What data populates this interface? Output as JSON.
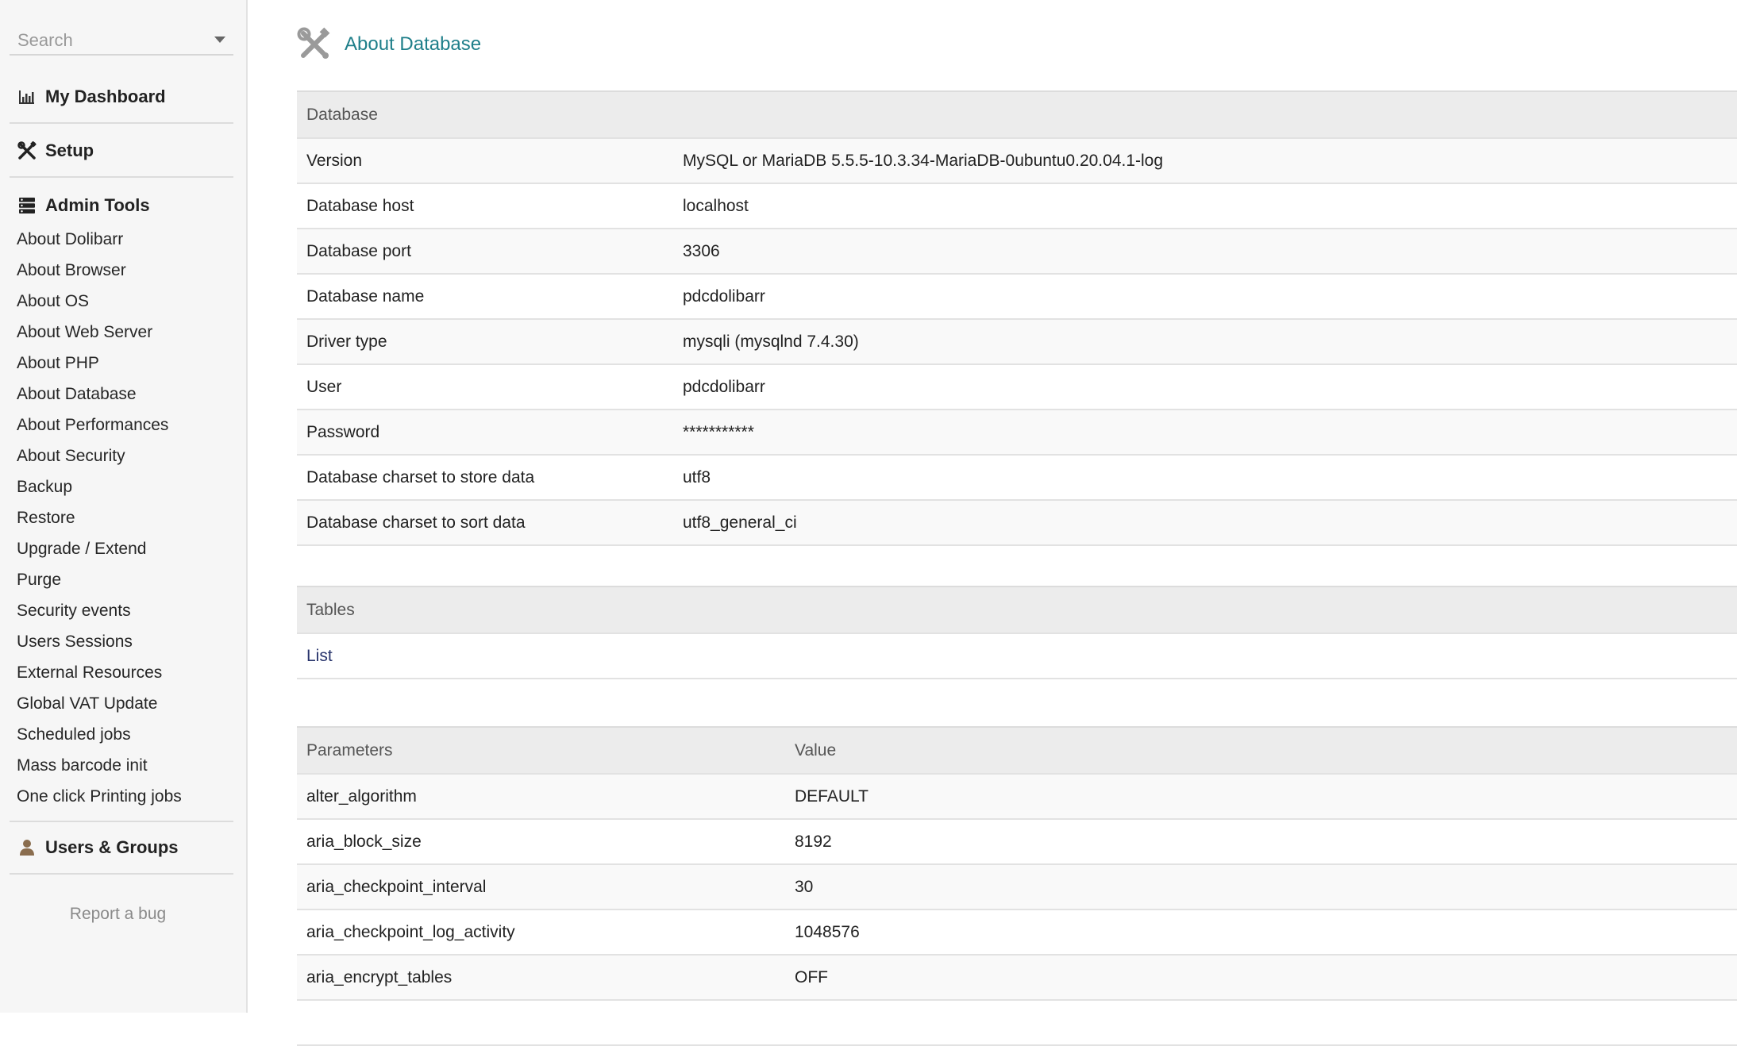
{
  "sidebar": {
    "search_placeholder": "Search",
    "dashboard": "My Dashboard",
    "setup": "Setup",
    "admin_tools": "Admin Tools",
    "admin_items": [
      "About Dolibarr",
      "About Browser",
      "About OS",
      "About Web Server",
      "About PHP",
      "About Database",
      "About Performances",
      "About Security",
      "Backup",
      "Restore",
      "Upgrade / Extend",
      "Purge",
      "Security events",
      "Users Sessions",
      "External Resources",
      "Global VAT Update",
      "Scheduled jobs",
      "Mass barcode init",
      "One click Printing jobs"
    ],
    "users_groups": "Users & Groups",
    "report_bug": "Report a bug"
  },
  "page": {
    "title": "About Database"
  },
  "database": {
    "header": "Database",
    "rows": [
      {
        "label": "Version",
        "value": "MySQL or MariaDB 5.5.5-10.3.34-MariaDB-0ubuntu0.20.04.1-log"
      },
      {
        "label": "Database host",
        "value": "localhost"
      },
      {
        "label": "Database port",
        "value": "3306"
      },
      {
        "label": "Database name",
        "value": "pdcdolibarr"
      },
      {
        "label": "Driver type",
        "value": "mysqli (mysqlnd 7.4.30)"
      },
      {
        "label": "User",
        "value": "pdcdolibarr"
      },
      {
        "label": "Password",
        "value": "***********"
      },
      {
        "label": "Database charset to store data",
        "value": "utf8"
      },
      {
        "label": "Database charset to sort data",
        "value": "utf8_general_ci"
      }
    ]
  },
  "tables": {
    "header": "Tables",
    "list_link": "List"
  },
  "parameters": {
    "col_param": "Parameters",
    "col_value": "Value",
    "rows": [
      {
        "name": "alter_algorithm",
        "value": "DEFAULT"
      },
      {
        "name": "aria_block_size",
        "value": "8192"
      },
      {
        "name": "aria_checkpoint_interval",
        "value": "30"
      },
      {
        "name": "aria_checkpoint_log_activity",
        "value": "1048576"
      },
      {
        "name": "aria_encrypt_tables",
        "value": "OFF"
      }
    ]
  },
  "colors": {
    "title": "#1f7f8a",
    "link": "#27336b",
    "header_bg": "#ececec",
    "sidebar_bg": "#f6f6f6"
  }
}
